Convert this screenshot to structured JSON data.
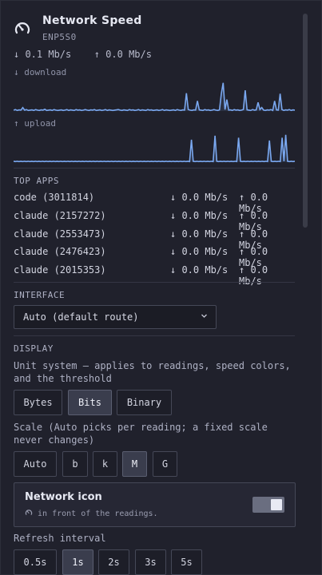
{
  "header": {
    "title": "Network Speed",
    "interface_name": "ENP5S0",
    "download_rate": "↓ 0.1 Mb/s",
    "upload_rate": "↑ 0.0 Mb/s"
  },
  "graphs": {
    "download_label": "↓ download",
    "upload_label": "↑ upload",
    "line_color": "#7aa8f0",
    "download_series": [
      0.03,
      0.05,
      0.02,
      0.04,
      0.03,
      0.12,
      0.03,
      0.05,
      0.02,
      0.03,
      0.04,
      0.02,
      0.05,
      0.03,
      0.02,
      0.04,
      0.03,
      0.06,
      0.02,
      0.03,
      0.04,
      0.02,
      0.05,
      0.03,
      0.02,
      0.03,
      0.04,
      0.02,
      0.03,
      0.05,
      0.02,
      0.04,
      0.03,
      0.02,
      0.05,
      0.03,
      0.04,
      0.02,
      0.03,
      0.05,
      0.03,
      0.02,
      0.04,
      0.03,
      0.05,
      0.02,
      0.03,
      0.04,
      0.02,
      0.03,
      0.05,
      0.02,
      0.04,
      0.03,
      0.02,
      0.03,
      0.04,
      0.05,
      0.03,
      0.02,
      0.04,
      0.03,
      0.02,
      0.05,
      0.03,
      0.04,
      0.02,
      0.03,
      0.05,
      0.02,
      0.04,
      0.03,
      0.02,
      0.05,
      0.03,
      0.04,
      0.02,
      0.03,
      0.04,
      0.02,
      0.03,
      0.05,
      0.02,
      0.04,
      0.03,
      0.02,
      0.03,
      0.04,
      0.02,
      0.05,
      0.03,
      0.02,
      0.04,
      0.03,
      0.62,
      0.05,
      0.03,
      0.02,
      0.04,
      0.03,
      0.35,
      0.04,
      0.03,
      0.02,
      0.05,
      0.03,
      0.04,
      0.02,
      0.03,
      0.05,
      0.03,
      0.02,
      0.04,
      0.6,
      0.98,
      0.05,
      0.4,
      0.03,
      0.04,
      0.02,
      0.05,
      0.03,
      0.04,
      0.02,
      0.03,
      0.05,
      0.72,
      0.04,
      0.03,
      0.02,
      0.05,
      0.03,
      0.04,
      0.3,
      0.05,
      0.12,
      0.03,
      0.02,
      0.04,
      0.03,
      0.05,
      0.02,
      0.35,
      0.04,
      0.03,
      0.6,
      0.05,
      0.02,
      0.04,
      0.03,
      0.05,
      0.02,
      0.04,
      0.03
    ],
    "upload_series": [
      0.03,
      0.02,
      0.03,
      0.02,
      0.03,
      0.02,
      0.03,
      0.02,
      0.03,
      0.02,
      0.03,
      0.02,
      0.03,
      0.02,
      0.03,
      0.02,
      0.03,
      0.02,
      0.03,
      0.02,
      0.03,
      0.02,
      0.03,
      0.02,
      0.03,
      0.02,
      0.03,
      0.02,
      0.03,
      0.02,
      0.03,
      0.02,
      0.03,
      0.02,
      0.03,
      0.02,
      0.03,
      0.02,
      0.03,
      0.02,
      0.03,
      0.02,
      0.03,
      0.02,
      0.03,
      0.02,
      0.03,
      0.02,
      0.03,
      0.02,
      0.03,
      0.02,
      0.03,
      0.02,
      0.03,
      0.02,
      0.03,
      0.02,
      0.03,
      0.02,
      0.03,
      0.02,
      0.03,
      0.02,
      0.03,
      0.02,
      0.03,
      0.02,
      0.03,
      0.02,
      0.03,
      0.02,
      0.03,
      0.02,
      0.03,
      0.02,
      0.03,
      0.02,
      0.03,
      0.02,
      0.03,
      0.02,
      0.03,
      0.02,
      0.03,
      0.02,
      0.03,
      0.02,
      0.03,
      0.02,
      0.03,
      0.02,
      0.03,
      0.02,
      0.03,
      0.02,
      0.03,
      0.02,
      0.78,
      0.03,
      0.02,
      0.03,
      0.02,
      0.03,
      0.02,
      0.03,
      0.02,
      0.03,
      0.02,
      0.03,
      0.02,
      0.92,
      0.03,
      0.02,
      0.03,
      0.02,
      0.03,
      0.02,
      0.03,
      0.02,
      0.03,
      0.02,
      0.03,
      0.02,
      0.85,
      0.03,
      0.02,
      0.03,
      0.02,
      0.03,
      0.02,
      0.03,
      0.02,
      0.03,
      0.02,
      0.03,
      0.02,
      0.03,
      0.02,
      0.03,
      0.02,
      0.75,
      0.03,
      0.02,
      0.03,
      0.02,
      0.03,
      0.02,
      0.85,
      0.03,
      0.95,
      0.03,
      0.02,
      0.03,
      0.02,
      0.03
    ]
  },
  "top_apps": {
    "label": "TOP APPS",
    "rows": [
      {
        "name": "code (3011814)",
        "down": "↓ 0.0 Mb/s",
        "up": "↑ 0.0 Mb/s"
      },
      {
        "name": "claude (2157272)",
        "down": "↓ 0.0 Mb/s",
        "up": "↑ 0.0 Mb/s"
      },
      {
        "name": "claude (2553473)",
        "down": "↓ 0.0 Mb/s",
        "up": "↑ 0.0 Mb/s"
      },
      {
        "name": "claude (2476423)",
        "down": "↓ 0.0 Mb/s",
        "up": "↑ 0.0 Mb/s"
      },
      {
        "name": "claude (2015353)",
        "down": "↓ 0.0 Mb/s",
        "up": "↑ 0.0 Mb/s"
      }
    ]
  },
  "interface": {
    "label": "INTERFACE",
    "selected": "Auto (default route)"
  },
  "display": {
    "label": "DISPLAY",
    "unit_help": "Unit system — applies to readings, speed colors, and the threshold",
    "units": [
      "Bytes",
      "Bits",
      "Binary"
    ],
    "units_active": "Bits",
    "scale_help": "Scale (Auto picks per reading; a fixed scale never changes)",
    "scales": [
      "Auto",
      "b",
      "k",
      "M",
      "G"
    ],
    "scale_active": "M"
  },
  "network_icon": {
    "title": "Network icon",
    "subtitle": "in front of the readings.",
    "enabled": true
  },
  "refresh": {
    "label": "Refresh interval",
    "options": [
      "0.5s",
      "1s",
      "2s",
      "3s",
      "5s"
    ],
    "active": "1s"
  }
}
